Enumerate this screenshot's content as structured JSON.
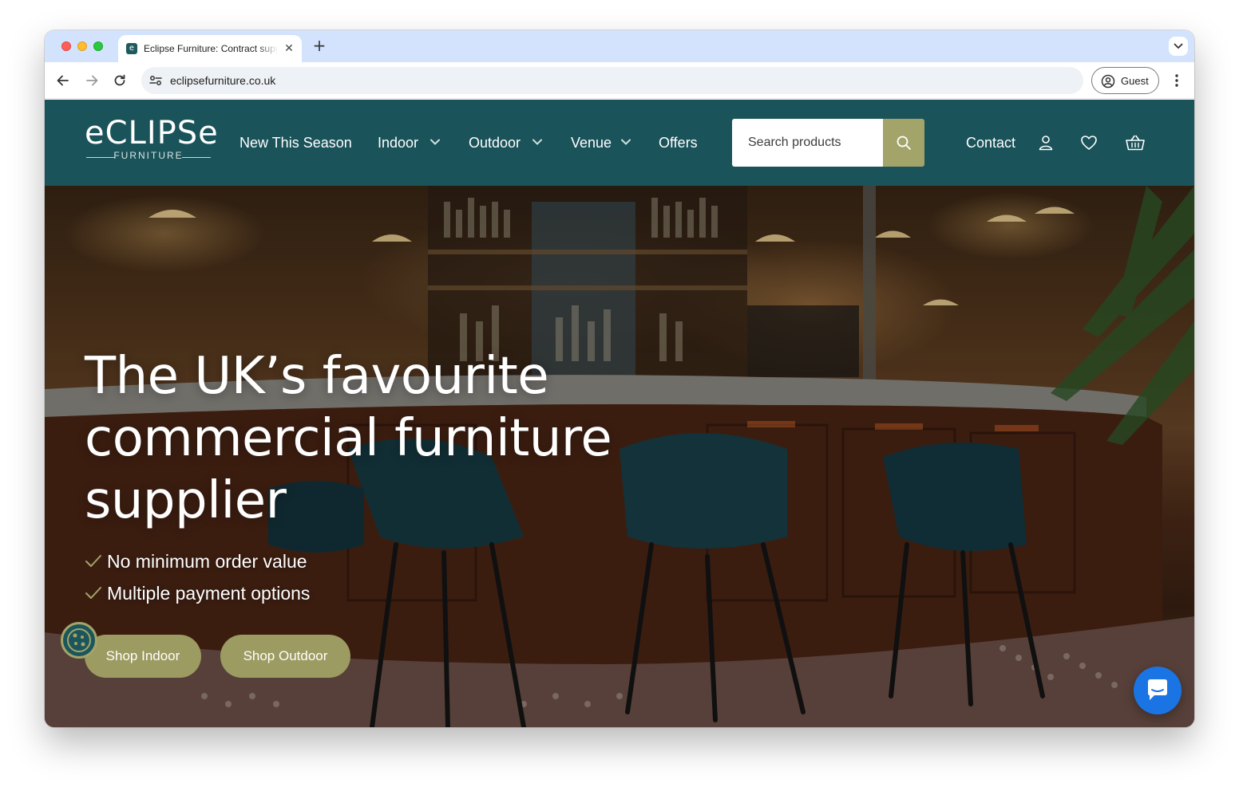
{
  "browser": {
    "tab_title": "Eclipse Furniture: Contract supplier",
    "tab_favicon_glyph": "e",
    "close_glyph": "✕",
    "new_tab_glyph": "+",
    "url": "eclipsefurniture.co.uk",
    "profile_label": "Guest",
    "icons": [
      "back-arrow-icon",
      "forward-arrow-icon",
      "reload-icon",
      "site-settings-icon",
      "profile-icon",
      "kebab-menu-icon",
      "tab-list-chevron-icon"
    ]
  },
  "header": {
    "logo_word": "eCLIPSe",
    "logo_sub": "FURNITURE",
    "nav": [
      {
        "label": "New This Season",
        "has_dropdown": false
      },
      {
        "label": "Indoor",
        "has_dropdown": true
      },
      {
        "label": "Outdoor",
        "has_dropdown": true
      },
      {
        "label": "Venue",
        "has_dropdown": true
      },
      {
        "label": "Offers",
        "has_dropdown": false
      }
    ],
    "search_placeholder": "Search products",
    "contact_label": "Contact",
    "icons": [
      "search-icon",
      "account-icon",
      "wishlist-heart-icon",
      "basket-icon"
    ]
  },
  "hero": {
    "title": "The UK’s favourite commercial furniture supplier",
    "features": [
      "No minimum order value",
      "Multiple payment options"
    ],
    "cta_indoor": "Shop Indoor",
    "cta_outdoor": "Shop Outdoor"
  },
  "widgets": {
    "cookie_icon": "cookie-icon",
    "chat_icon": "chat-bubble-icon"
  },
  "colors": {
    "header_bg": "#1a535a",
    "accent_olive": "#a3a46a",
    "cta_bg": "#9c9b62",
    "chat_blue": "#1b74e4",
    "tabstrip_bg": "#d3e3fd"
  }
}
